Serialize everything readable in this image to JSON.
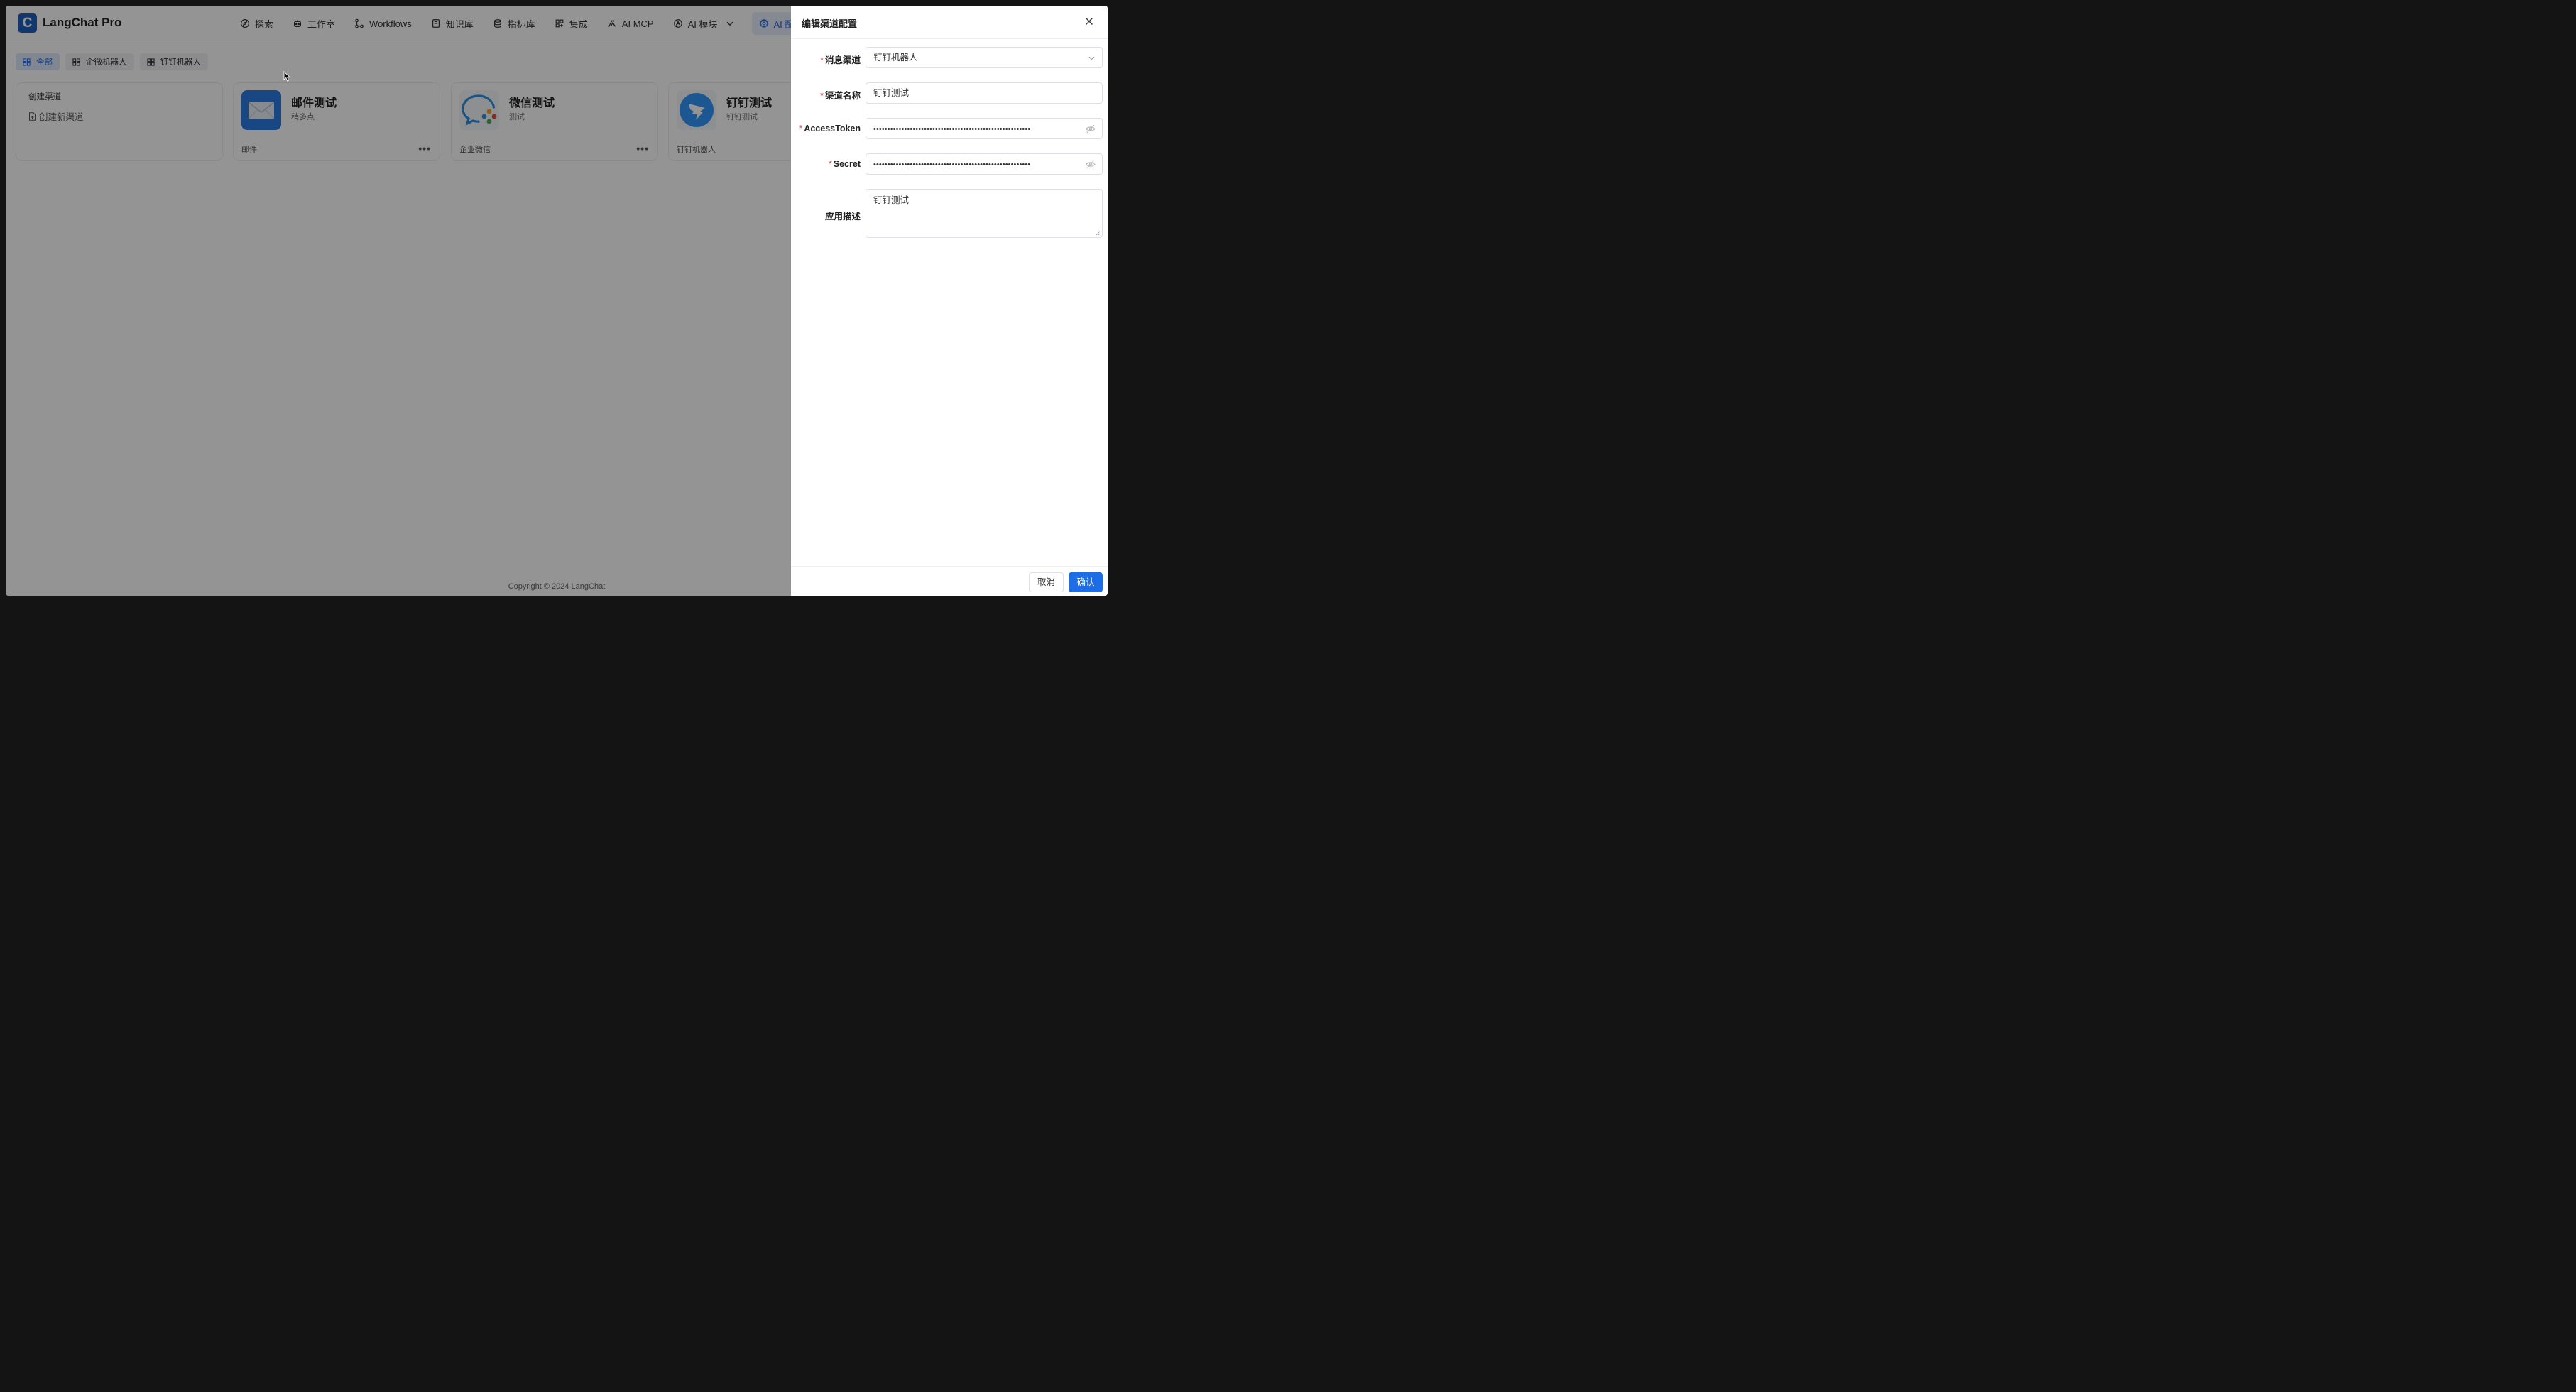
{
  "app": {
    "logo_letter": "C",
    "title": "LangChat Pro"
  },
  "nav": {
    "items": [
      {
        "label": "探索",
        "icon": "compass-icon"
      },
      {
        "label": "工作室",
        "icon": "robot-icon"
      },
      {
        "label": "Workflows",
        "icon": "workflow-icon"
      },
      {
        "label": "知识库",
        "icon": "book-icon"
      },
      {
        "label": "指标库",
        "icon": "database-icon"
      },
      {
        "label": "集成",
        "icon": "grid-plus-icon"
      },
      {
        "label": "AI MCP",
        "icon": "mcp-icon"
      },
      {
        "label": "AI 模块",
        "icon": "module-icon"
      },
      {
        "label": "AI 配置",
        "icon": "gear-icon"
      }
    ],
    "active": "AI 配置"
  },
  "filters": {
    "items": [
      "全部",
      "企微机器人",
      "钉钉机器人"
    ],
    "active": "全部"
  },
  "create_card": {
    "title": "创建渠道",
    "link": "创建新渠道"
  },
  "cards": [
    {
      "name": "邮件测试",
      "desc": "稍多点",
      "type": "邮件",
      "icon": "mail-icon",
      "color": "#2a7be4"
    },
    {
      "name": "微信测试",
      "desc": "测试",
      "type": "企业微信",
      "icon": "wecom-icon",
      "color": "#2f8fe0"
    },
    {
      "name": "钉钉测试",
      "desc": "钉钉测试",
      "type": "钉钉机器人",
      "icon": "dingtalk-icon",
      "color": "#3296fa"
    }
  ],
  "footer": {
    "copyright": "Copyright © 2024 LangChat"
  },
  "drawer": {
    "title": "编辑渠道配置",
    "fields": {
      "channel": {
        "label": "消息渠道",
        "value": "钉钉机器人",
        "required": true
      },
      "name": {
        "label": "渠道名称",
        "value": "钉钉测试",
        "required": true
      },
      "access_token": {
        "label": "AccessToken",
        "value": "••••••••••••••••••••••••••••••••••••••••••••••••••••••••",
        "required": true
      },
      "secret": {
        "label": "Secret",
        "value": "••••••••••••••••••••••••••••••••••••••••••••••••••••••••",
        "required": true
      },
      "description": {
        "label": "应用描述",
        "value": "钉钉测试",
        "required": false
      }
    },
    "cancel_label": "取消",
    "confirm_label": "确认"
  }
}
